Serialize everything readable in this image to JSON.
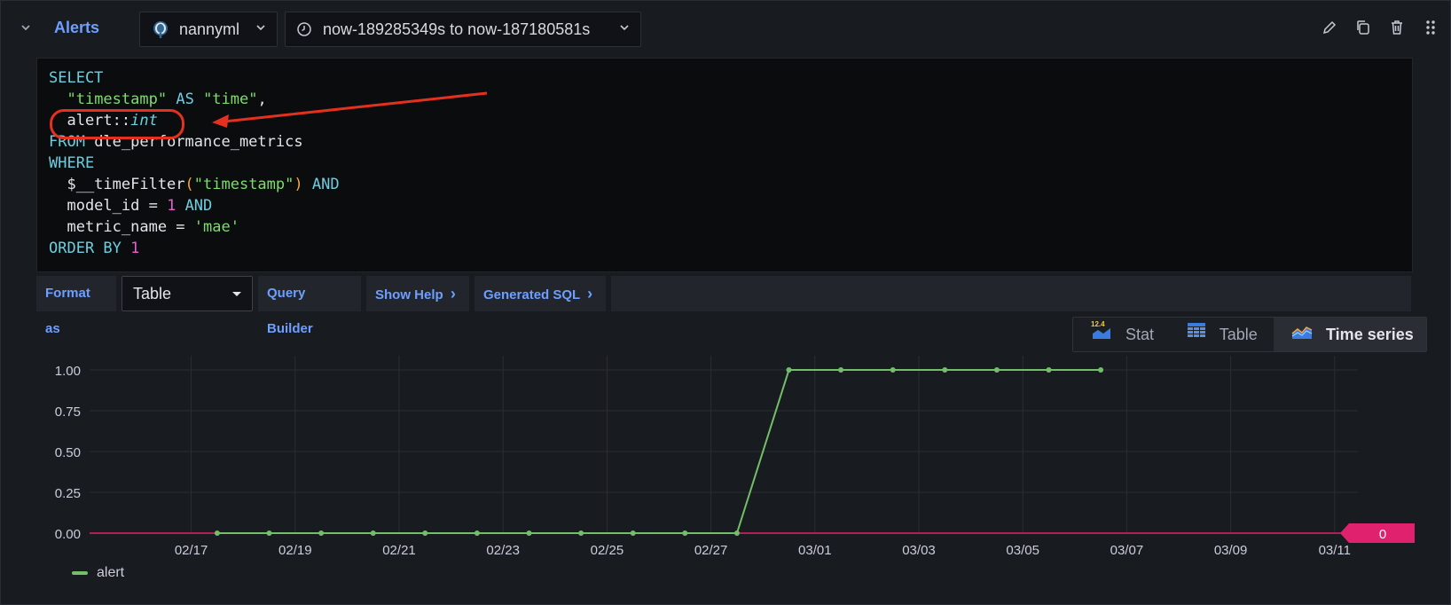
{
  "header": {
    "title": "Alerts",
    "datasource": "nannyml",
    "time_range": "now-189285349s to now-187180581s"
  },
  "query": {
    "lines": [
      [
        [
          "kw",
          "SELECT"
        ]
      ],
      [
        [
          "plain",
          "  "
        ],
        [
          "str",
          "\"timestamp\""
        ],
        [
          "plain",
          " "
        ],
        [
          "kw",
          "AS"
        ],
        [
          "plain",
          " "
        ],
        [
          "str",
          "\"time\""
        ],
        [
          "plain",
          ","
        ]
      ],
      [
        [
          "plain",
          "  alert::"
        ],
        [
          "typ",
          "int"
        ]
      ],
      [
        [
          "kw",
          "FROM"
        ],
        [
          "plain",
          " dle_performance_metrics"
        ]
      ],
      [
        [
          "kw",
          "WHERE"
        ]
      ],
      [
        [
          "plain",
          "  $__timeFilter"
        ],
        [
          "paren",
          "("
        ],
        [
          "str",
          "\"timestamp\""
        ],
        [
          "paren",
          ")"
        ],
        [
          "plain",
          " "
        ],
        [
          "kw",
          "AND"
        ]
      ],
      [
        [
          "plain",
          "  model_id = "
        ],
        [
          "num",
          "1"
        ],
        [
          "plain",
          " "
        ],
        [
          "kw",
          "AND"
        ]
      ],
      [
        [
          "plain",
          "  metric_name = "
        ],
        [
          "str",
          "'mae'"
        ]
      ],
      [
        [
          "kw",
          "ORDER BY"
        ],
        [
          "plain",
          " "
        ],
        [
          "num",
          "1"
        ]
      ]
    ]
  },
  "toolbar": {
    "format_as_label": "Format as",
    "format_value": "Table",
    "query_builder_label": "Query Builder",
    "show_help_label": "Show Help",
    "generated_sql_label": "Generated SQL",
    "chevron_glyph": "›"
  },
  "viz_switcher": {
    "options": [
      {
        "label": "Stat",
        "icon": "stat-icon",
        "badge": "12.4"
      },
      {
        "label": "Table",
        "icon": "table-icon"
      },
      {
        "label": "Time series",
        "icon": "time-series-icon",
        "active": true
      }
    ]
  },
  "colors": {
    "series": "#73bf69",
    "threshold": "#e0226e",
    "accent": "#6e9fff",
    "annotation": "#e5301f"
  },
  "chart_data": {
    "type": "line",
    "x_ticks": [
      "02/17",
      "02/19",
      "02/21",
      "02/23",
      "02/25",
      "02/27",
      "03/01",
      "03/03",
      "03/05",
      "03/07",
      "03/09",
      "03/11"
    ],
    "y_ticks": [
      "1.00",
      "0.75",
      "0.50",
      "0.25",
      "0.00"
    ],
    "ylim": [
      0,
      1
    ],
    "xlim_days": [
      -1,
      23.3
    ],
    "series": [
      {
        "name": "alert",
        "x_days": [
          0.5,
          1.5,
          2.5,
          3.5,
          4.5,
          5.5,
          6.5,
          7.5,
          8.5,
          9.5,
          10.5,
          11.5,
          12.5,
          13.5,
          14.5,
          15.5,
          16.5,
          17.5
        ],
        "values": [
          0,
          0,
          0,
          0,
          0,
          0,
          0,
          0,
          0,
          0,
          0,
          1,
          1,
          1,
          1,
          1,
          1,
          1
        ]
      }
    ],
    "threshold": {
      "value": 0,
      "label": "0"
    },
    "legend": "bottom-left",
    "grid": true
  }
}
